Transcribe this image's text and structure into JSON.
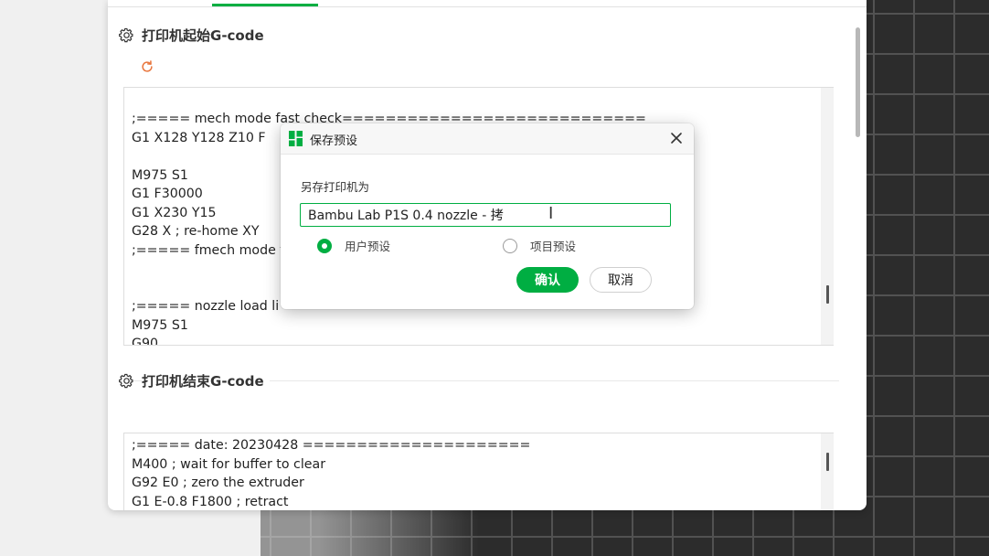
{
  "start_gcode": {
    "title": "打印机起始G-code",
    "lines": [
      ";===== mech mode fast check============================",
      "G1 X128 Y128 Z10 F",
      "",
      "M975 S1",
      "G1 F30000",
      "G1 X230 Y15",
      "G28 X ; re-home XY",
      ";===== fmech mode f",
      "",
      "",
      ";===== nozzle load li",
      "M975 S1",
      "G90"
    ]
  },
  "end_gcode": {
    "title": "打印机结束G-code",
    "lines": [
      ";===== date: 20230428 =====================",
      "M400 ; wait for buffer to clear",
      "G92 E0 ; zero the extruder",
      "G1 E-0.8 F1800 ; retract"
    ]
  },
  "dialog": {
    "title": "保存预设",
    "label": "另存打印机为",
    "input_value": "Bambu Lab P1S 0.4 nozzle - 拷",
    "radio_user": "用户预设",
    "radio_project": "项目预设",
    "selected": "user",
    "confirm": "确认",
    "cancel": "取消"
  },
  "colors": {
    "accent": "#00ae42",
    "grid_bg": "#2c2c2c",
    "grid_line": "#525252"
  },
  "icons": {
    "section": "gear-icon",
    "reset": "reset-icon",
    "close": "close-icon",
    "logo": "bambu-logo-icon"
  }
}
